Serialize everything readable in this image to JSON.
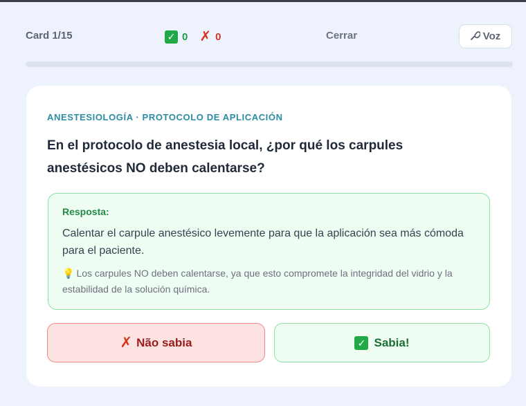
{
  "header": {
    "card_counter": "Card 1/15",
    "correct_count": "0",
    "incorrect_count": "0",
    "close_label": "Cerrar",
    "voice_label": "Voz"
  },
  "progress": {
    "fraction": 0.0
  },
  "card": {
    "category": "ANESTESIOLOGÍA · PROTOCOLO DE APLICACIÓN",
    "question": "En el protocolo de anestesia local, ¿por qué los carpules anestésicos NO deben calentarse?",
    "answer_label": "Resposta:",
    "answer_text": "Calentar el carpule anestésico levemente para que la aplicación sea más cómoda para el paciente.",
    "tip_text": "Los carpules NO deben calentarse, ya que esto compromete la integridad del vidrio y la estabilidad de la solución química."
  },
  "actions": {
    "no_label": "Não sabia",
    "yes_label": "Sabia!"
  },
  "icons": {
    "correct": "check-box-icon",
    "incorrect": "x-icon",
    "voice": "microphone-icon",
    "tip": "lightbulb-icon"
  },
  "colors": {
    "success": "#22a847",
    "danger": "#d4341b",
    "category": "#2b8ca3",
    "background": "#eef2fc"
  }
}
